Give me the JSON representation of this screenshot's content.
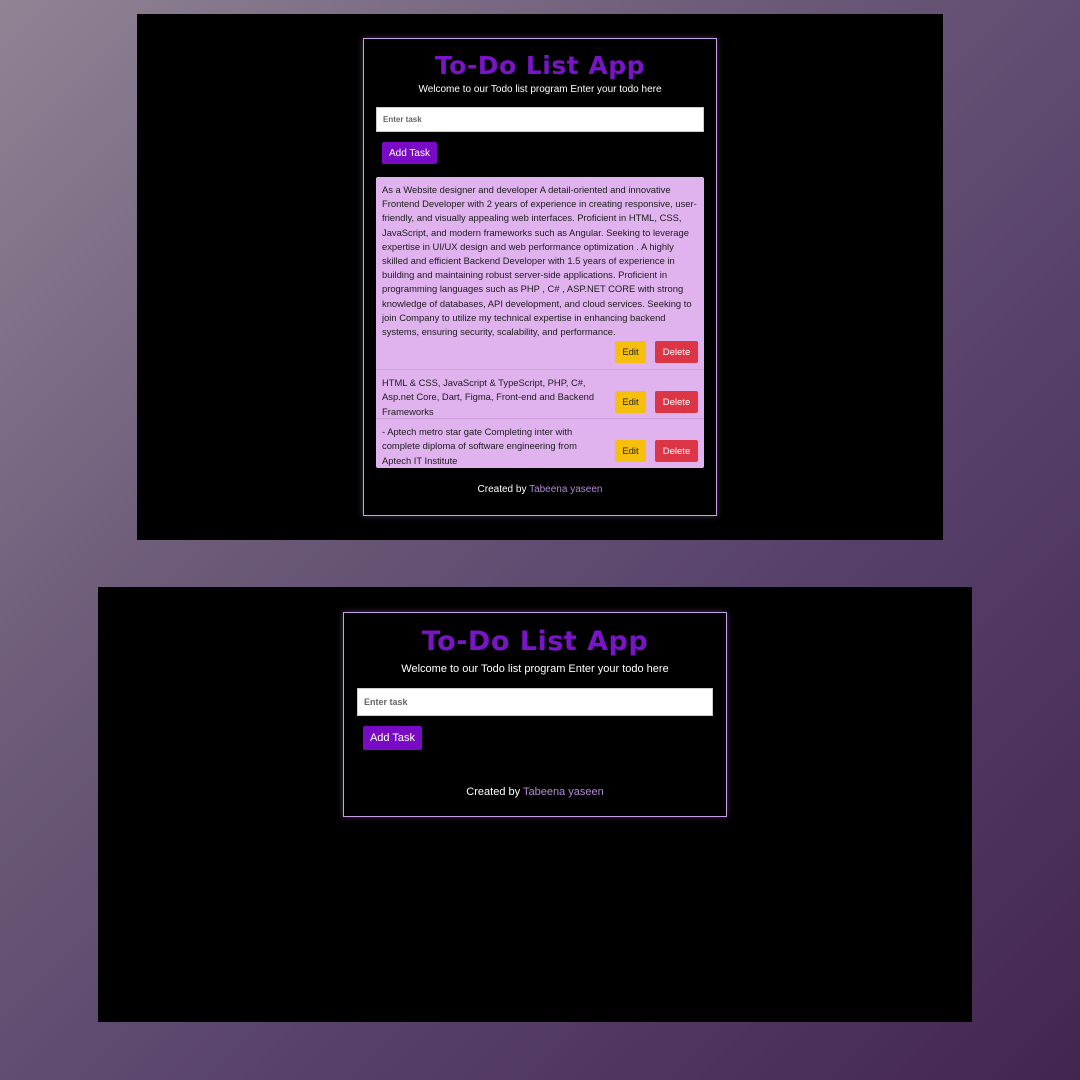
{
  "app": {
    "title": "To-Do List App",
    "subtitle": "Welcome to our Todo list program Enter your todo here",
    "input_placeholder": "Enter task",
    "add_button_label": "Add Task",
    "footer_prefix": "Created by",
    "footer_author": "Tabeena yaseen"
  },
  "tasks": [
    {
      "text": "As a Website designer and developer A detail-oriented and innovative Frontend Developer with 2 years of experience in creating responsive, user-friendly, and visually appealing web interfaces. Proficient in HTML, CSS, JavaScript, and modern frameworks such as Angular. Seeking to leverage expertise in UI/UX design and web performance optimization . A highly skilled and efficient Backend Developer with 1.5 years of experience in building and maintaining robust server-side applications. Proficient in programming languages such as PHP , C# , ASP.NET CORE with strong knowledge of databases, API development, and cloud services. Seeking to join Company to utilize my technical expertise in enhancing backend systems, ensuring security, scalability, and performance.",
      "edit_label": "Edit",
      "delete_label": "Delete"
    },
    {
      "text": "HTML & CSS, JavaScript & TypeScript, PHP, C#, Asp.net Core, Dart, Figma, Front-end and Backend Frameworks",
      "edit_label": "Edit",
      "delete_label": "Delete"
    },
    {
      "text": "- Aptech metro star gate Completing inter with complete diploma of software engineering from Aptech IT Institute",
      "edit_label": "Edit",
      "delete_label": "Delete"
    }
  ],
  "colors": {
    "title": "#7a14c7",
    "add_button": "#7a0bc4",
    "task_list_bg": "#e0b3ee",
    "edit_button": "#f5bf0c",
    "delete_button": "#dc3545",
    "card_border": "#c9a2e6",
    "author_link": "#b38ad6"
  }
}
